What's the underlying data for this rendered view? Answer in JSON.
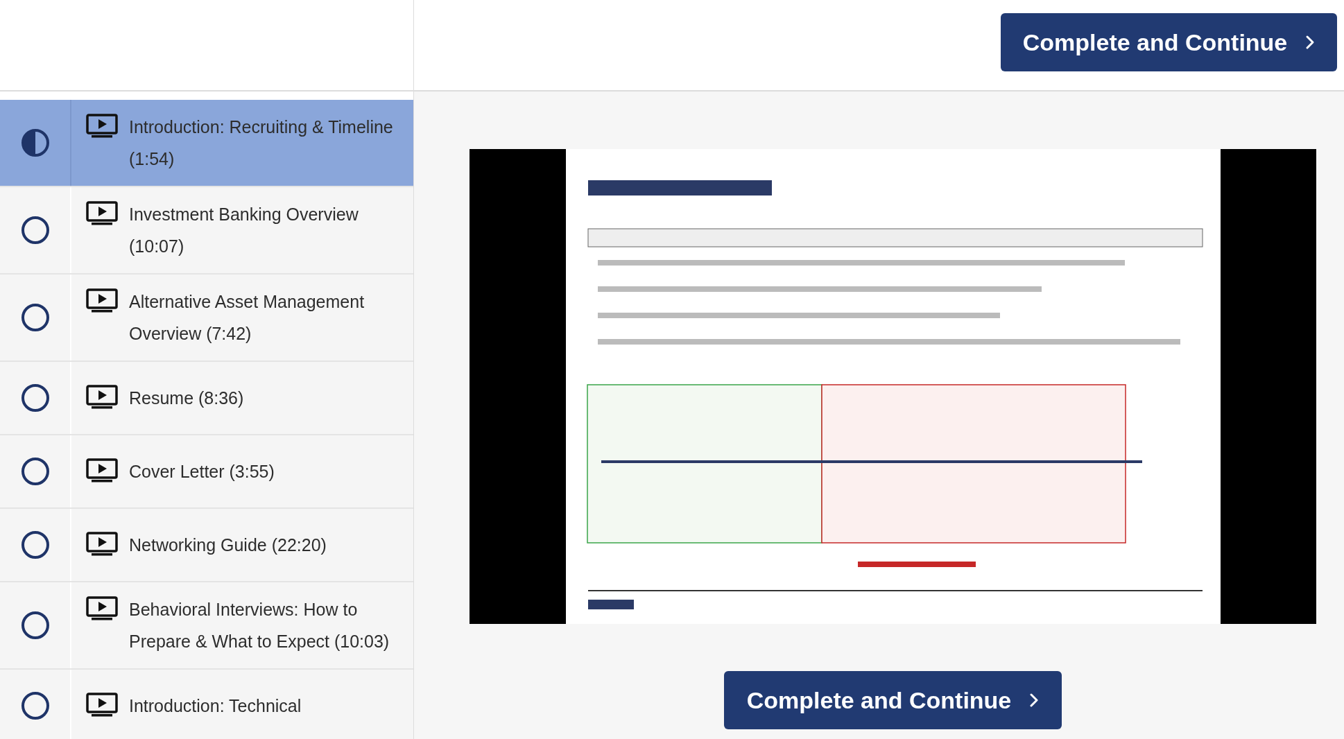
{
  "header": {
    "button": "Complete and Continue"
  },
  "lessons": [
    {
      "title": "Introduction: Recruiting & Timeline (1:54)",
      "in_progress": true,
      "selected": true
    },
    {
      "title": "Investment Banking Overview (10:07)",
      "in_progress": false,
      "selected": false
    },
    {
      "title": "Alternative Asset Management Overview (7:42)",
      "in_progress": false,
      "selected": false
    },
    {
      "title": "Resume (8:36)",
      "in_progress": false,
      "selected": false
    },
    {
      "title": "Cover Letter (3:55)",
      "in_progress": false,
      "selected": false
    },
    {
      "title": "Networking Guide (22:20)",
      "in_progress": false,
      "selected": false
    },
    {
      "title": "Behavioral Interviews: How to Prepare & What to Expect (10:03)",
      "in_progress": false,
      "selected": false
    },
    {
      "title": "Introduction: Technical",
      "in_progress": false,
      "selected": false
    }
  ],
  "footer": {
    "button": "Complete and Continue"
  }
}
